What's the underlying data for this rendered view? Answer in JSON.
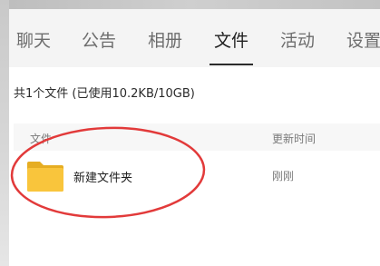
{
  "tabs": [
    {
      "label": "聊天"
    },
    {
      "label": "公告"
    },
    {
      "label": "相册"
    },
    {
      "label": "文件"
    },
    {
      "label": "活动"
    },
    {
      "label": "设置"
    }
  ],
  "active_tab": "文件",
  "summary": "共1个文件 (已使用10.2KB/10GB)",
  "columns": {
    "name": "文件",
    "updated": "更新时间"
  },
  "files": [
    {
      "name": "新建文件夹",
      "updated": "刚刚",
      "icon": "folder-icon"
    }
  ],
  "colors": {
    "folder": "#f9c53c",
    "annotation": "#e23a3a",
    "tab_bar": "#f4f4f4"
  }
}
